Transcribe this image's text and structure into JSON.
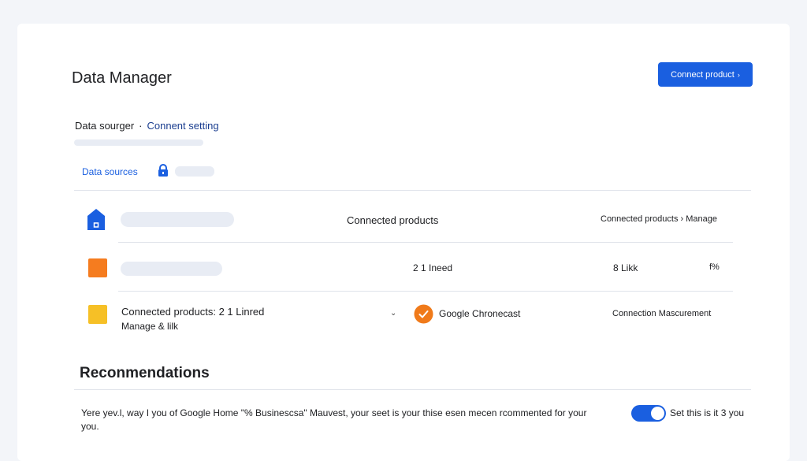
{
  "header": {
    "title": "Data Manager",
    "connect_button": "Connect product",
    "connect_arrow": "›"
  },
  "breadcrumb": {
    "first": "Data sourger",
    "separator": "·",
    "second": "Connent setting"
  },
  "tabs": {
    "data_sources": "Data sources"
  },
  "table": {
    "rows": [
      {
        "icon": "house-icon",
        "col_main": "Connected products",
        "col_right": "Connected products › Manage"
      },
      {
        "icon": "orange-square-icon",
        "col_main": "2  1 Ineed",
        "col_link": "8 Likk",
        "col_pct": "f%"
      },
      {
        "icon": "yellow-square-icon",
        "name_line1": "Connected products: 2 1 Linred",
        "name_line2": "Manage & lilk",
        "product": "Google Chronecast",
        "measurement": "Connection Mascurement"
      }
    ]
  },
  "recommendations": {
    "title": "Reconmendations",
    "text": "Yere yev.l, way I you of Google Home \"% Businescsa\" Mauvest, your seet is your thise esen mecen rcommented for your you.",
    "toggle_label": "Set this is it 3 you",
    "toggle_on": true
  },
  "colors": {
    "accent": "#1a5fe0",
    "orange": "#f57c1f",
    "yellow": "#f6c026",
    "check_orange": "#f07a1a"
  }
}
